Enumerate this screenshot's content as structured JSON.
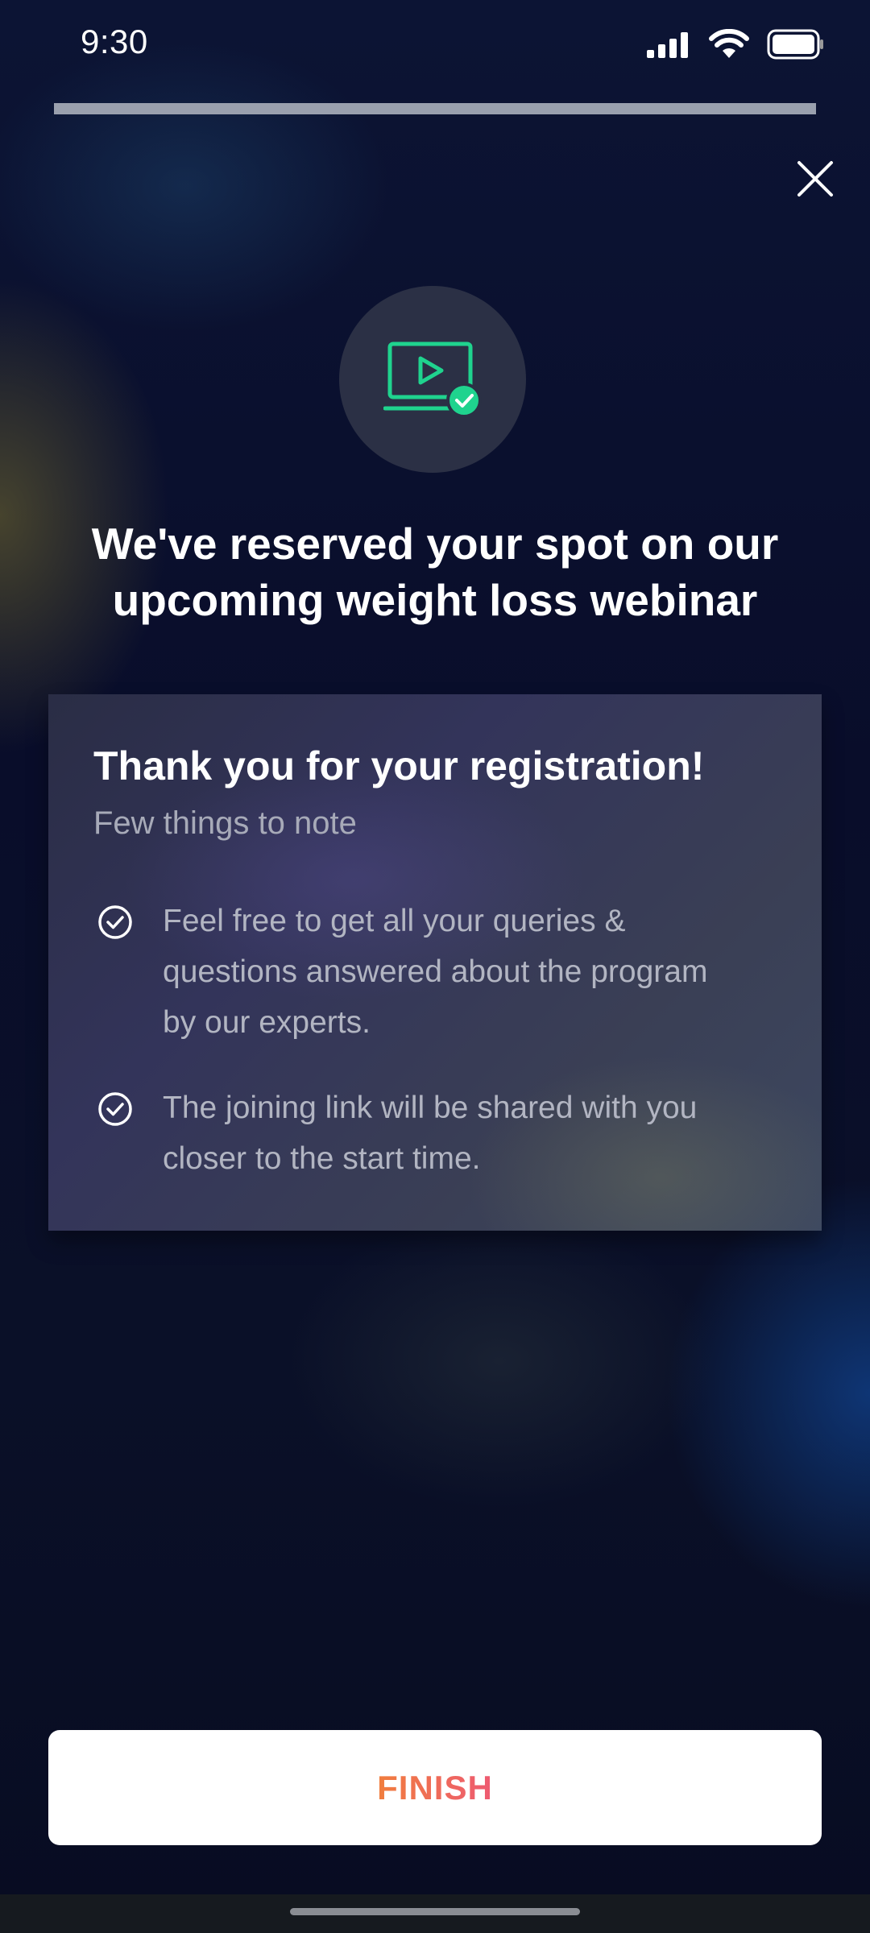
{
  "status_bar": {
    "time": "9:30",
    "icons": [
      "signal-icon",
      "wifi-icon",
      "battery-icon"
    ]
  },
  "progress": {
    "value_percent": 100
  },
  "close_icon": "close-icon",
  "hero_icon": "video-check-icon",
  "headline": "We've reserved your spot on our upcoming weight loss webinar",
  "card": {
    "title": "Thank you for your registration!",
    "subtitle": "Few things to note",
    "items": [
      {
        "text": "Feel free to get all your queries & questions answered about the program by our experts.",
        "icon": "check-circle-icon"
      },
      {
        "text": "The joining link will be shared with you closer to the start time.",
        "icon": "check-circle-icon"
      }
    ]
  },
  "finish_button": {
    "label": "FINISH"
  },
  "colors": {
    "accent_green": "#1fd38e",
    "button_gradient_start": "#f07e3e",
    "button_gradient_end": "#ee5a72",
    "background": "#0a0f2a"
  }
}
